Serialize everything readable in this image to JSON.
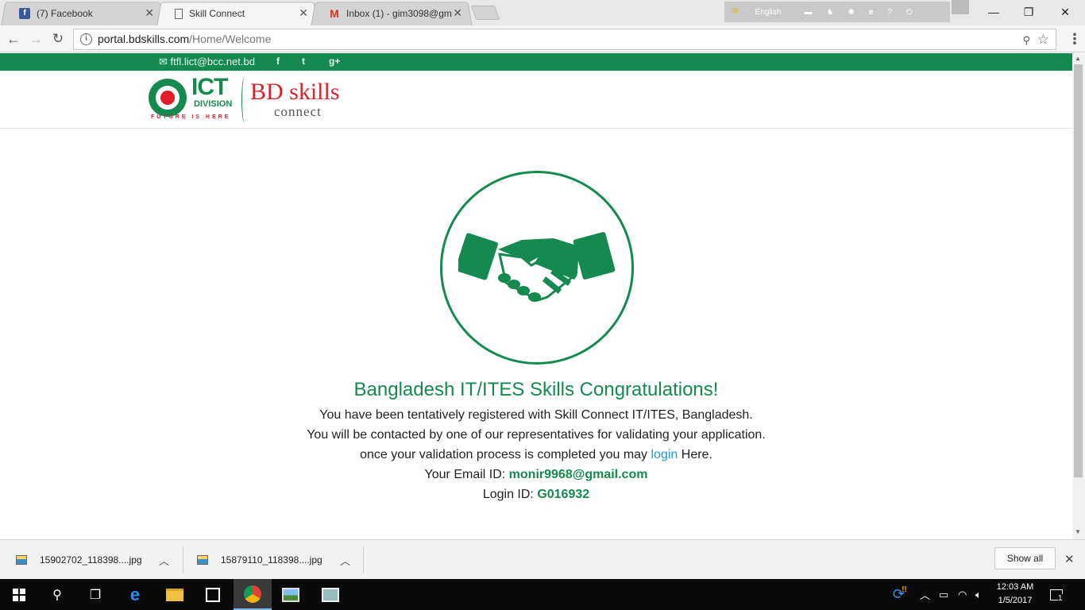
{
  "browser": {
    "tabs": [
      {
        "title": "(7) Facebook",
        "favicon": "facebook-icon",
        "active": false
      },
      {
        "title": "Skill Connect",
        "favicon": "page-icon",
        "active": true
      },
      {
        "title": "Inbox (1) - gim3098@gm",
        "favicon": "gmail-icon",
        "active": false
      }
    ],
    "ime": {
      "lang": "English"
    },
    "url_host": "portal.bdskills.com",
    "url_path": "/Home/Welcome"
  },
  "site": {
    "contact_email": "ftfl.lict@bcc.net.bd",
    "social": {
      "facebook": "f",
      "twitter": "t",
      "gplus": "g+"
    },
    "logo": {
      "ict": "ICT",
      "division": "DIVISION",
      "tagline": "FUTURE IS HERE",
      "brand": "BD skills",
      "brand_sub": "connect"
    }
  },
  "content": {
    "heading": "Bangladesh IT/ITES Skills Congratulations!",
    "line1": "You have been tentatively registered with Skill Connect IT/ITES, Bangladesh.",
    "line2": "You will be contacted by one of our representatives for validating your application.",
    "line3_pre": "once your validation process is completed you may ",
    "line3_link": "login",
    "line3_post": " Here.",
    "email_label": "Your Email ID: ",
    "email_value": "monir9968@gmail.com",
    "login_label": "Login ID: ",
    "login_value": "G016932"
  },
  "downloads": {
    "items": [
      {
        "name": "15902702_118398....jpg"
      },
      {
        "name": "15879110_118398....jpg"
      }
    ],
    "show_all": "Show all"
  },
  "taskbar": {
    "time": "12:03 AM",
    "date": "1/5/2017",
    "notifications": "1"
  },
  "colors": {
    "brand_green": "#148a4e",
    "link_blue": "#1e9bd7",
    "brand_red": "#d6232c"
  }
}
